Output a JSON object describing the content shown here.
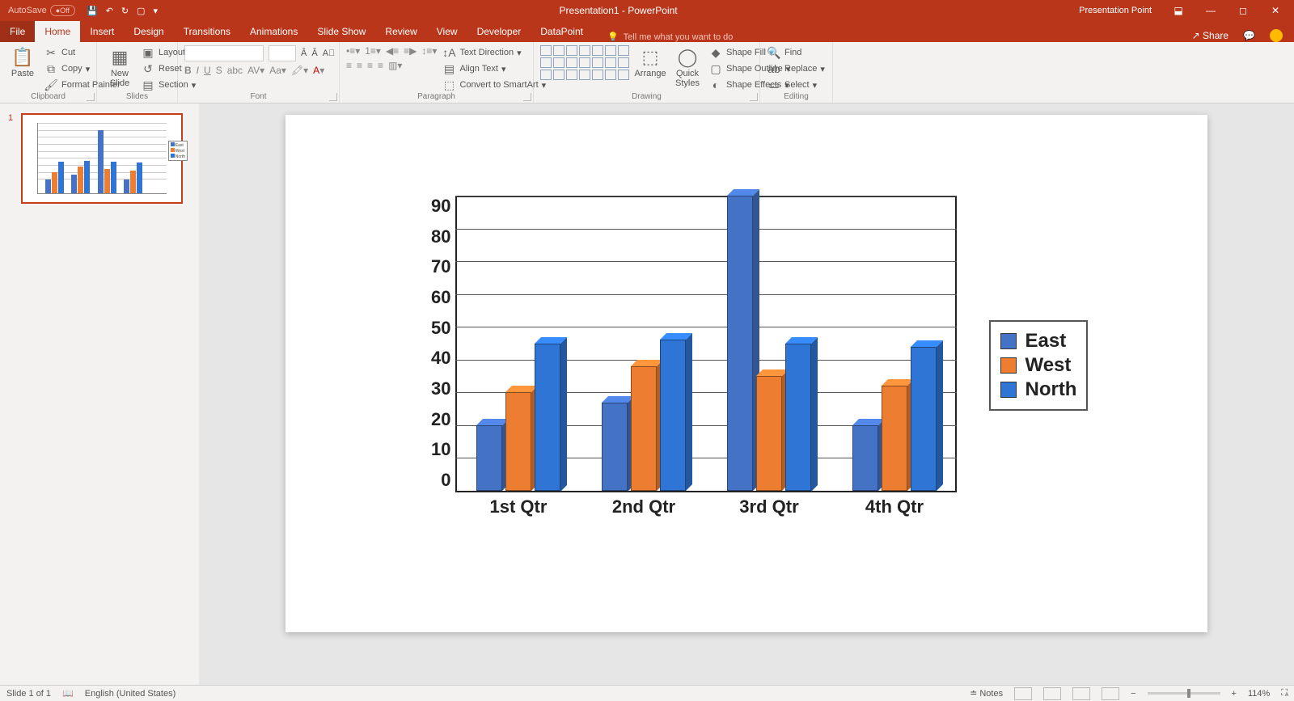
{
  "titlebar": {
    "autosave_label": "AutoSave",
    "autosave_state": "Off",
    "doc_title": "Presentation1 - PowerPoint",
    "right_label": "Presentation Point"
  },
  "tabs": {
    "items": [
      "File",
      "Home",
      "Insert",
      "Design",
      "Transitions",
      "Animations",
      "Slide Show",
      "Review",
      "View",
      "Developer",
      "DataPoint"
    ],
    "active_index": 1,
    "tell_me": "Tell me what you want to do",
    "share": "Share"
  },
  "ribbon": {
    "clipboard": {
      "paste": "Paste",
      "cut": "Cut",
      "copy": "Copy",
      "painter": "Format Painter",
      "label": "Clipboard"
    },
    "slides": {
      "new": "New\nSlide",
      "layout": "Layout",
      "reset": "Reset",
      "section": "Section",
      "label": "Slides"
    },
    "font": {
      "label": "Font"
    },
    "paragraph": {
      "dir": "Text Direction",
      "align": "Align Text",
      "smart": "Convert to SmartArt",
      "label": "Paragraph"
    },
    "drawing": {
      "arrange": "Arrange",
      "quick": "Quick\nStyles",
      "fill": "Shape Fill",
      "outline": "Shape Outline",
      "effects": "Shape Effects",
      "label": "Drawing"
    },
    "editing": {
      "find": "Find",
      "replace": "Replace",
      "select": "Select",
      "label": "Editing"
    }
  },
  "thumb": {
    "num": "1"
  },
  "status": {
    "slide": "Slide 1 of 1",
    "lang": "English (United States)",
    "notes": "Notes",
    "zoom": "114%"
  },
  "chart_data": {
    "type": "bar",
    "categories": [
      "1st Qtr",
      "2nd Qtr",
      "3rd Qtr",
      "4th Qtr"
    ],
    "series": [
      {
        "name": "East",
        "color": "#4472c4",
        "values": [
          20,
          27,
          90,
          20
        ]
      },
      {
        "name": "West",
        "color": "#ed7d31",
        "values": [
          30,
          38,
          35,
          32
        ]
      },
      {
        "name": "North",
        "color": "#2e75d6",
        "values": [
          45,
          46,
          45,
          44
        ]
      }
    ],
    "ylim": [
      0,
      90
    ],
    "yticks": [
      0,
      10,
      20,
      30,
      40,
      50,
      60,
      70,
      80,
      90
    ]
  }
}
